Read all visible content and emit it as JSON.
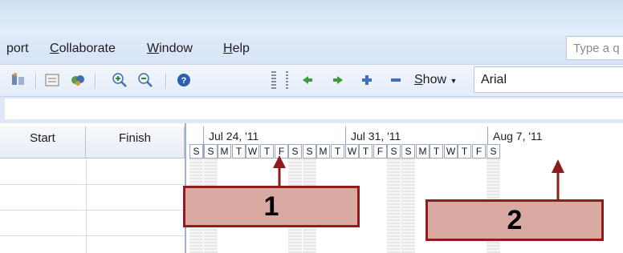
{
  "menu": {
    "items": [
      {
        "label": "port",
        "underline": ""
      },
      {
        "label": "Collaborate",
        "underline": "C"
      },
      {
        "label": "Window",
        "underline": "W"
      },
      {
        "label": "Help",
        "underline": "H"
      }
    ],
    "help_search_placeholder": "Type a q"
  },
  "toolbar": {
    "icons": [
      "assign-resources-icon",
      "task-info-icon",
      "copy-picture-icon",
      "zoom-in-icon",
      "zoom-out-icon",
      "help-icon"
    ],
    "nav_icons": [
      "outdent-left-icon",
      "indent-right-icon",
      "plus-icon",
      "minus-icon"
    ],
    "show_label": "Show",
    "show_underline": "S",
    "font_name": "Arial"
  },
  "table": {
    "columns": [
      "Start",
      "Finish"
    ]
  },
  "timescale": {
    "weeks": [
      "Jul 24, '11",
      "Jul 31, '11",
      "Aug 7, '11"
    ],
    "days": [
      "S",
      "S",
      "M",
      "T",
      "W",
      "T",
      "F",
      "S",
      "S",
      "M",
      "T",
      "W",
      "T",
      "F",
      "S",
      "S",
      "M",
      "T",
      "W",
      "T",
      "F",
      "S"
    ]
  },
  "callouts": [
    {
      "number": "1"
    },
    {
      "number": "2"
    }
  ],
  "colors": {
    "callout_fill": "#d8aaa2",
    "callout_border": "#8f1b1b",
    "arrow": "#8f1b1b"
  }
}
